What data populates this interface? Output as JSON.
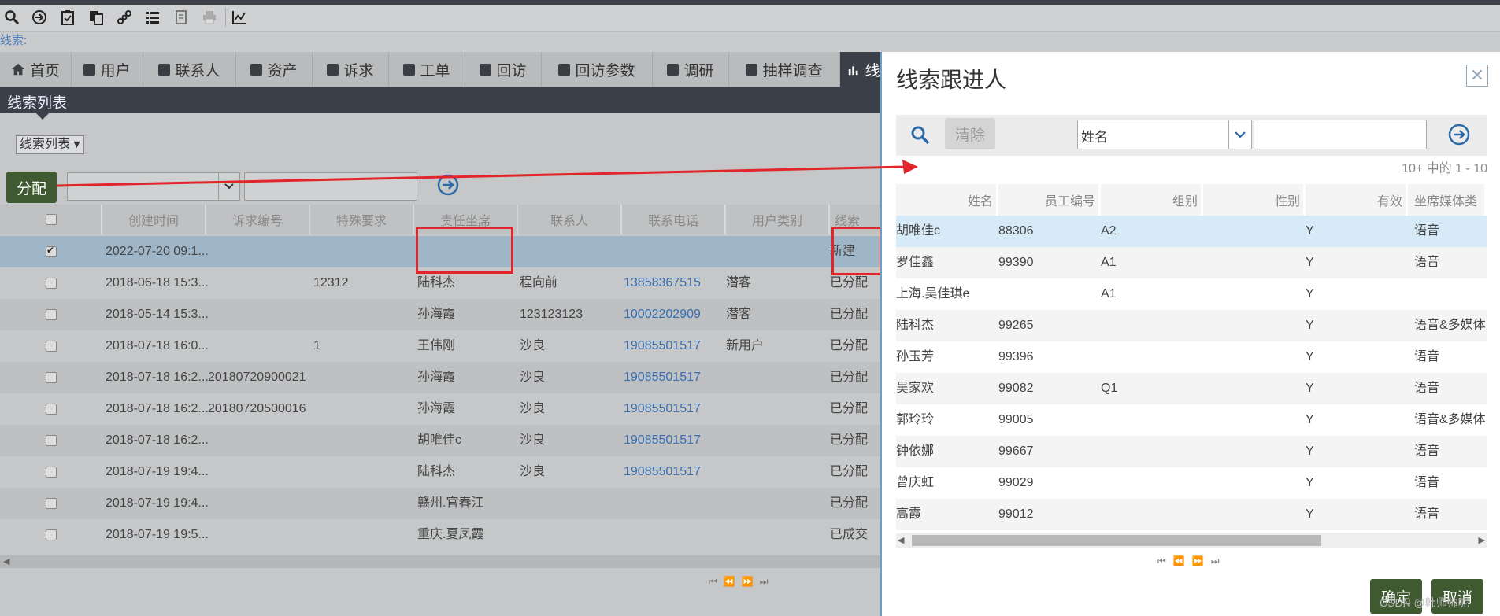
{
  "toolbar": {
    "icons": [
      "search-icon",
      "forward-icon",
      "clipboard-check-icon",
      "copy-icon",
      "link-icon",
      "list-icon",
      "document-icon",
      "print-icon",
      "chart-icon"
    ]
  },
  "search_label": "线索:",
  "tabs": [
    {
      "label": "首页",
      "icon": "home-icon"
    },
    {
      "label": "用户"
    },
    {
      "label": "联系人"
    },
    {
      "label": "资产"
    },
    {
      "label": "诉求"
    },
    {
      "label": "工单"
    },
    {
      "label": "回访"
    },
    {
      "label": "回访参数"
    },
    {
      "label": "调研"
    },
    {
      "label": "抽样调查"
    },
    {
      "label": "线",
      "icon": "chart-bar-icon"
    }
  ],
  "list_header": "线索列表",
  "view_select": "线索列表",
  "assign_button": "分配",
  "left_grid": {
    "columns": [
      "创建时间",
      "诉求编号",
      "特殊要求",
      "责任坐席",
      "联系人",
      "联系电话",
      "用户类别",
      "线索"
    ],
    "rows": [
      {
        "checked": true,
        "created": "2022-07-20 09:1...",
        "req_no": "",
        "special": "",
        "agent": "",
        "contact": "",
        "phone": "",
        "user_type": "",
        "status": "新建"
      },
      {
        "checked": false,
        "created": "2018-06-18 15:3...",
        "req_no": "",
        "special": "12312",
        "agent": "陆科杰",
        "contact": "程向前",
        "phone": "13858367515",
        "user_type": "潜客",
        "status": "已分配"
      },
      {
        "checked": false,
        "created": "2018-05-14 15:3...",
        "req_no": "",
        "special": "",
        "agent": "孙海霞",
        "contact": "123123123",
        "phone": "10002202909",
        "user_type": "潜客",
        "status": "已分配"
      },
      {
        "checked": false,
        "created": "2018-07-18 16:0...",
        "req_no": "",
        "special": "1",
        "agent": "王伟刚",
        "contact": "沙良",
        "phone": "19085501517",
        "user_type": "新用户",
        "status": "已分配"
      },
      {
        "checked": false,
        "created": "2018-07-18 16:2...",
        "req_no": "20180720900021",
        "special": "",
        "agent": "孙海霞",
        "contact": "沙良",
        "phone": "19085501517",
        "user_type": "",
        "status": "已分配"
      },
      {
        "checked": false,
        "created": "2018-07-18 16:2...",
        "req_no": "20180720500016",
        "special": "",
        "agent": "孙海霞",
        "contact": "沙良",
        "phone": "19085501517",
        "user_type": "",
        "status": "已分配"
      },
      {
        "checked": false,
        "created": "2018-07-18 16:2...",
        "req_no": "",
        "special": "",
        "agent": "胡唯佳c",
        "contact": "沙良",
        "phone": "19085501517",
        "user_type": "",
        "status": "已分配"
      },
      {
        "checked": false,
        "created": "2018-07-19 19:4...",
        "req_no": "",
        "special": "",
        "agent": "陆科杰",
        "contact": "沙良",
        "phone": "19085501517",
        "user_type": "",
        "status": "已分配"
      },
      {
        "checked": false,
        "created": "2018-07-19 19:4...",
        "req_no": "",
        "special": "",
        "agent": "赣州.官春江",
        "contact": "",
        "phone": "",
        "user_type": "",
        "status": "已分配"
      },
      {
        "checked": false,
        "created": "2018-07-19 19:5...",
        "req_no": "",
        "special": "",
        "agent": "重庆.夏凤霞",
        "contact": "",
        "phone": "",
        "user_type": "",
        "status": "已成交"
      }
    ]
  },
  "panel": {
    "title": "线索跟进人",
    "clear_button": "清除",
    "field_select": "姓名",
    "count_text": "10+ 中的 1 - 10",
    "columns": [
      "姓名",
      "员工编号",
      "组别",
      "性别",
      "有效",
      "坐席媒体类"
    ],
    "rows": [
      {
        "name": "胡唯佳c",
        "emp_no": "88306",
        "group": "A2",
        "gender": "",
        "valid": "Y",
        "media": "语音"
      },
      {
        "name": "罗佳鑫",
        "emp_no": "99390",
        "group": "A1",
        "gender": "",
        "valid": "Y",
        "media": "语音"
      },
      {
        "name": "上海.吴佳琪e",
        "emp_no": "",
        "group": "A1",
        "gender": "",
        "valid": "Y",
        "media": ""
      },
      {
        "name": "陆科杰",
        "emp_no": "99265",
        "group": "",
        "gender": "",
        "valid": "Y",
        "media": "语音&多媒体"
      },
      {
        "name": "孙玉芳",
        "emp_no": "99396",
        "group": "",
        "gender": "",
        "valid": "Y",
        "media": "语音"
      },
      {
        "name": "吴家欢",
        "emp_no": "99082",
        "group": "Q1",
        "gender": "",
        "valid": "Y",
        "media": "语音"
      },
      {
        "name": "郭玲玲",
        "emp_no": "99005",
        "group": "",
        "gender": "",
        "valid": "Y",
        "media": "语音&多媒体"
      },
      {
        "name": "钟依娜",
        "emp_no": "99667",
        "group": "",
        "gender": "",
        "valid": "Y",
        "media": "语音"
      },
      {
        "name": "曾庆虹",
        "emp_no": "99029",
        "group": "",
        "gender": "",
        "valid": "Y",
        "media": "语音"
      },
      {
        "name": "高霞",
        "emp_no": "99012",
        "group": "",
        "gender": "",
        "valid": "Y",
        "media": "语音"
      }
    ],
    "confirm_button": "确定",
    "cancel_button": "取消"
  },
  "watermark": "CSDN @韩师帅呢",
  "colors": {
    "highlight": "#e0262a",
    "accent": "#3f5a31",
    "link": "#3a6fb0",
    "selected_row": "#d6eaf8"
  }
}
